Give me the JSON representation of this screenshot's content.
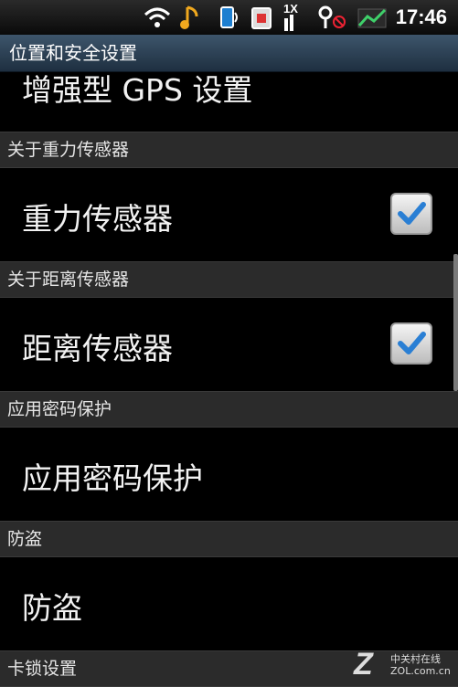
{
  "status_bar": {
    "time": "17:46",
    "icons": [
      "wifi-icon",
      "music-note-icon",
      "phone-icon",
      "sim-icon",
      "1x-signal-icon",
      "alarm-icon",
      "signal-strength-icon"
    ],
    "network_label": "1X"
  },
  "title_bar": {
    "title": "位置和安全设置"
  },
  "settings": {
    "partial_item_label": "增强型 GPS 设置",
    "sections": [
      {
        "header": "关于重力传感器",
        "item": "重力传感器",
        "checked": true
      },
      {
        "header": "关于距离传感器",
        "item": "距离传感器",
        "checked": true
      },
      {
        "header": "应用密码保护",
        "item": "应用密码保护"
      },
      {
        "header": "防盗",
        "item": "防盗"
      },
      {
        "header": "卡锁设置"
      }
    ]
  },
  "watermark": {
    "logo": "Z",
    "cn": "中关村在线",
    "url": "ZOL.com.cn"
  },
  "colors": {
    "check_accent": "#2a7fd4",
    "title_bar": "#34495c"
  }
}
